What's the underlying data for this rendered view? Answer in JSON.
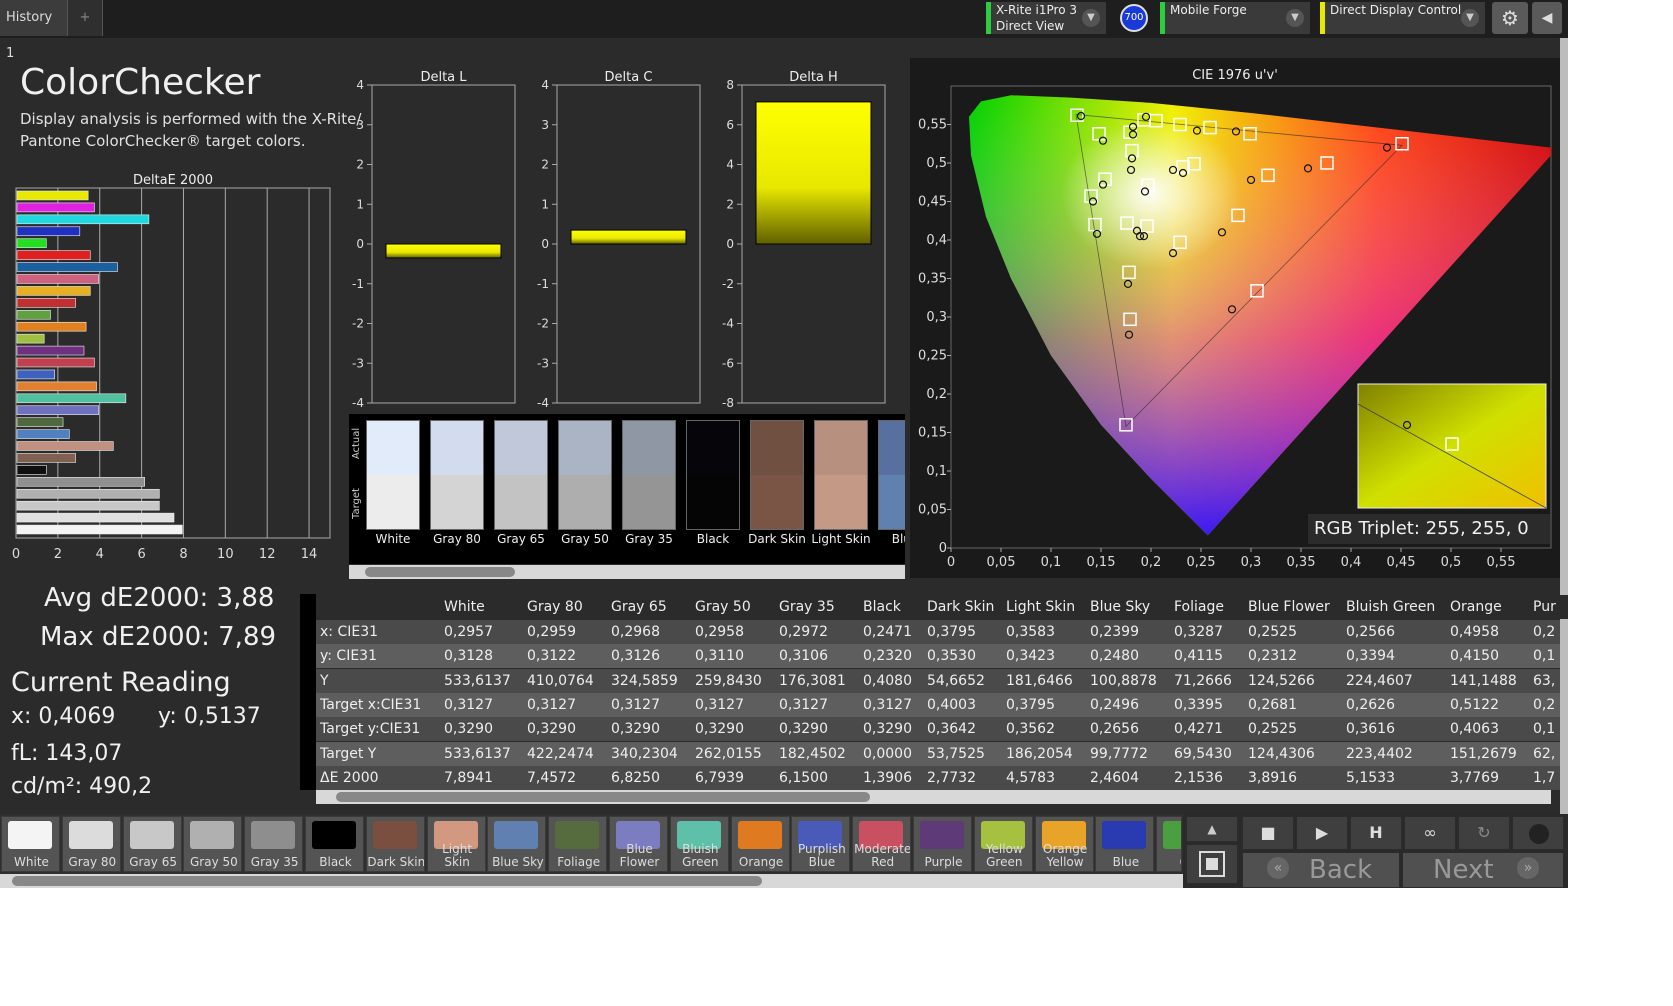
{
  "tabs": [
    {
      "label": "History 1"
    }
  ],
  "tab_add": "+",
  "devices": [
    {
      "line1": "X-Rite i1Pro 3",
      "line2": "Direct View"
    },
    {
      "line1": "Mobile Forge",
      "line2": ""
    },
    {
      "line1": "Direct Display Control",
      "line2": ""
    }
  ],
  "device_badge": "700",
  "page": {
    "title": "ColorChecker",
    "description_l1": "Display analysis is performed with the X-Rite/",
    "description_l2": "Pantone ColorChecker® target colors."
  },
  "summary": {
    "avg": "Avg dE2000: 3,88",
    "max": "Max dE2000: 7,89",
    "current_reading": "Current Reading",
    "x": "x: 0,4069",
    "y": "y: 0,5137",
    "fl": "fL: 143,07",
    "cdm": "cd/m²: 490,2"
  },
  "chart_data": [
    {
      "type": "bar",
      "title": "DeltaE 2000",
      "orientation": "horizontal",
      "xlim": [
        0,
        15
      ],
      "xticks": [
        "0",
        "2",
        "4",
        "6",
        "8",
        "10",
        "12",
        "14"
      ],
      "bars": [
        {
          "value": 3.4,
          "color": "#e8e800"
        },
        {
          "value": 3.7,
          "color": "#e020e0"
        },
        {
          "value": 6.3,
          "color": "#20d8e0"
        },
        {
          "value": 3.0,
          "color": "#2030c0"
        },
        {
          "value": 1.4,
          "color": "#20e020"
        },
        {
          "value": 3.5,
          "color": "#e02020"
        },
        {
          "value": 4.8,
          "color": "#1a60a0"
        },
        {
          "value": 3.9,
          "color": "#d06080"
        },
        {
          "value": 3.5,
          "color": "#e8b020"
        },
        {
          "value": 2.8,
          "color": "#c03030"
        },
        {
          "value": 1.6,
          "color": "#60a040"
        },
        {
          "value": 3.3,
          "color": "#e08020"
        },
        {
          "value": 1.3,
          "color": "#a0c040"
        },
        {
          "value": 3.2,
          "color": "#703080"
        },
        {
          "value": 3.7,
          "color": "#c04050"
        },
        {
          "value": 1.8,
          "color": "#4060c0"
        },
        {
          "value": 3.8,
          "color": "#e08030"
        },
        {
          "value": 5.2,
          "color": "#50c0a0"
        },
        {
          "value": 3.9,
          "color": "#7070c0"
        },
        {
          "value": 2.2,
          "color": "#506840"
        },
        {
          "value": 2.5,
          "color": "#5080c0"
        },
        {
          "value": 4.6,
          "color": "#c09080"
        },
        {
          "value": 2.8,
          "color": "#806050"
        },
        {
          "value": 1.4,
          "color": "#101010"
        },
        {
          "value": 6.1,
          "color": "#909090"
        },
        {
          "value": 6.8,
          "color": "#b0b0b0"
        },
        {
          "value": 6.8,
          "color": "#c8c8c8"
        },
        {
          "value": 7.5,
          "color": "#e0e0e0"
        },
        {
          "value": 7.9,
          "color": "#f4f4f4"
        }
      ]
    },
    {
      "type": "bar",
      "title": "Delta L",
      "ylim": [
        -4,
        4
      ],
      "yticks": [
        "4",
        "3",
        "2",
        "1",
        "0",
        "-1",
        "-2",
        "-3",
        "-4"
      ],
      "values": [
        -0.35
      ]
    },
    {
      "type": "bar",
      "title": "Delta C",
      "ylim": [
        -4,
        4
      ],
      "yticks": [
        "4",
        "3",
        "2",
        "1",
        "0",
        "-1",
        "-2",
        "-3",
        "-4"
      ],
      "values": [
        0.35
      ]
    },
    {
      "type": "bar",
      "title": "Delta H",
      "ylim": [
        -8,
        8
      ],
      "yticks": [
        "8",
        "6",
        "4",
        "2",
        "0",
        "-2",
        "-4",
        "-6",
        "-8"
      ],
      "values": [
        7.15
      ]
    },
    {
      "type": "scatter",
      "title": "CIE 1976 u'v'",
      "xlim": [
        0,
        0.6
      ],
      "ylim": [
        0,
        0.6
      ],
      "xticks": [
        "0",
        "0,05",
        "0,1",
        "0,15",
        "0,2",
        "0,25",
        "0,3",
        "0,35",
        "0,4",
        "0,45",
        "0,5",
        "0,55"
      ],
      "yticks": [
        "0",
        "0,05",
        "0,1",
        "0,15",
        "0,2",
        "0,25",
        "0,3",
        "0,35",
        "0,4",
        "0,45",
        "0,5",
        "0,55"
      ],
      "targets": [
        [
          0.126,
          0.562
        ],
        [
          0.148,
          0.538
        ],
        [
          0.179,
          0.54
        ],
        [
          0.193,
          0.556
        ],
        [
          0.205,
          0.555
        ],
        [
          0.229,
          0.55
        ],
        [
          0.259,
          0.546
        ],
        [
          0.299,
          0.538
        ],
        [
          0.181,
          0.516
        ],
        [
          0.232,
          0.495
        ],
        [
          0.243,
          0.499
        ],
        [
          0.317,
          0.484
        ],
        [
          0.376,
          0.5
        ],
        [
          0.451,
          0.525
        ],
        [
          0.154,
          0.479
        ],
        [
          0.197,
          0.471
        ],
        [
          0.14,
          0.457
        ],
        [
          0.287,
          0.432
        ],
        [
          0.144,
          0.42
        ],
        [
          0.176,
          0.422
        ],
        [
          0.196,
          0.418
        ],
        [
          0.229,
          0.397
        ],
        [
          0.178,
          0.358
        ],
        [
          0.306,
          0.334
        ],
        [
          0.179,
          0.297
        ],
        [
          0.175,
          0.16
        ]
      ],
      "measured": [
        [
          0.13,
          0.561
        ],
        [
          0.152,
          0.529
        ],
        [
          0.182,
          0.547
        ],
        [
          0.195,
          0.56
        ],
        [
          0.246,
          0.542
        ],
        [
          0.285,
          0.541
        ],
        [
          0.182,
          0.537
        ],
        [
          0.181,
          0.506
        ],
        [
          0.18,
          0.491
        ],
        [
          0.222,
          0.491
        ],
        [
          0.232,
          0.487
        ],
        [
          0.3,
          0.478
        ],
        [
          0.357,
          0.493
        ],
        [
          0.436,
          0.52
        ],
        [
          0.152,
          0.472
        ],
        [
          0.142,
          0.45
        ],
        [
          0.194,
          0.463
        ],
        [
          0.146,
          0.408
        ],
        [
          0.189,
          0.405
        ],
        [
          0.193,
          0.405
        ],
        [
          0.222,
          0.383
        ],
        [
          0.271,
          0.41
        ],
        [
          0.177,
          0.343
        ],
        [
          0.178,
          0.277
        ],
        [
          0.281,
          0.31
        ],
        [
          0.186,
          0.412
        ]
      ],
      "inset_label": "RGB Triplet: 255, 255, 0"
    }
  ],
  "swatch_strip": {
    "side_actual": "Actual",
    "side_target": "Target",
    "items": [
      {
        "name": "White",
        "actual": "#e1ebfa",
        "target": "#ececec"
      },
      {
        "name": "Gray 80",
        "actual": "#d2dcee",
        "target": "#d4d4d4"
      },
      {
        "name": "Gray 65",
        "actual": "#c0c8da",
        "target": "#c3c3c3"
      },
      {
        "name": "Gray 50",
        "actual": "#abb4c4",
        "target": "#aeaeae"
      },
      {
        "name": "Gray 35",
        "actual": "#8f96a4",
        "target": "#959595"
      },
      {
        "name": "Black",
        "actual": "#06060a",
        "target": "#050505"
      },
      {
        "name": "Dark Skin",
        "actual": "#705040",
        "target": "#7a5545"
      },
      {
        "name": "Light Skin",
        "actual": "#b89080",
        "target": "#c49a86"
      },
      {
        "name": "Blue",
        "actual": "#5870a0",
        "target": "#6080b0"
      }
    ]
  },
  "table": {
    "columns": [
      "White",
      "Gray 80",
      "Gray 65",
      "Gray 50",
      "Gray 35",
      "Black",
      "Dark Skin",
      "Light Skin",
      "Blue Sky",
      "Foliage",
      "Blue Flower",
      "Bluish Green",
      "Orange",
      "Pur"
    ],
    "rows": [
      {
        "label": "x: CIE31",
        "values": [
          "0,2957",
          "0,2959",
          "0,2968",
          "0,2958",
          "0,2972",
          "0,2471",
          "0,3795",
          "0,3583",
          "0,2399",
          "0,3287",
          "0,2525",
          "0,2566",
          "0,4958",
          "0,2"
        ]
      },
      {
        "label": "y: CIE31",
        "values": [
          "0,3128",
          "0,3122",
          "0,3126",
          "0,3110",
          "0,3106",
          "0,2320",
          "0,3530",
          "0,3423",
          "0,2480",
          "0,4115",
          "0,2312",
          "0,3394",
          "0,4150",
          "0,1"
        ]
      },
      {
        "label": "Y",
        "values": [
          "533,6137",
          "410,0764",
          "324,5859",
          "259,8430",
          "176,3081",
          "0,4080",
          "54,6652",
          "181,6466",
          "100,8878",
          "71,2666",
          "124,5266",
          "224,4607",
          "141,1488",
          "63,"
        ]
      },
      {
        "label": "Target x:CIE31",
        "values": [
          "0,3127",
          "0,3127",
          "0,3127",
          "0,3127",
          "0,3127",
          "0,3127",
          "0,4003",
          "0,3795",
          "0,2496",
          "0,3395",
          "0,2681",
          "0,2626",
          "0,5122",
          "0,2"
        ]
      },
      {
        "label": "Target y:CIE31",
        "values": [
          "0,3290",
          "0,3290",
          "0,3290",
          "0,3290",
          "0,3290",
          "0,3290",
          "0,3642",
          "0,3562",
          "0,2656",
          "0,4271",
          "0,2525",
          "0,3616",
          "0,4063",
          "0,1"
        ]
      },
      {
        "label": "Target Y",
        "values": [
          "533,6137",
          "422,2474",
          "340,2304",
          "262,0155",
          "182,4502",
          "0,0000",
          "53,7525",
          "186,2054",
          "99,7772",
          "69,5430",
          "124,4306",
          "223,4402",
          "151,2679",
          "62,"
        ]
      },
      {
        "label": "ΔE 2000",
        "values": [
          "7,8941",
          "7,4572",
          "6,8250",
          "6,7939",
          "6,1500",
          "1,3906",
          "2,7732",
          "4,5783",
          "2,4604",
          "2,1536",
          "3,8916",
          "5,1533",
          "3,7769",
          "1,7"
        ]
      }
    ]
  },
  "bottom_swatches": [
    {
      "label": "White",
      "color": "#f4f4f4"
    },
    {
      "label": "Gray 80",
      "color": "#dcdcdc"
    },
    {
      "label": "Gray 65",
      "color": "#c8c8c8"
    },
    {
      "label": "Gray 50",
      "color": "#b0b0b0"
    },
    {
      "label": "Gray 35",
      "color": "#8e8e8e"
    },
    {
      "label": "Black",
      "color": "#000000"
    },
    {
      "label": "Dark Skin",
      "color": "#7a4f40"
    },
    {
      "label": "Light Skin",
      "color": "#d29880"
    },
    {
      "label": "Blue Sky",
      "color": "#5f80b0"
    },
    {
      "label": "Foliage",
      "color": "#576c3e"
    },
    {
      "label": "Blue Flower",
      "color": "#7c7cc0"
    },
    {
      "label": "Bluish Green",
      "color": "#5ec0a8"
    },
    {
      "label": "Orange",
      "color": "#e07a20"
    },
    {
      "label": "Purplish Blue",
      "color": "#4a5ab8"
    },
    {
      "label": "Moderate Red",
      "color": "#c85060"
    },
    {
      "label": "Purple",
      "color": "#5e3a78"
    },
    {
      "label": "Yellow Green",
      "color": "#a6c040"
    },
    {
      "label": "Orange Yellow",
      "color": "#e8a428"
    },
    {
      "label": "Blue",
      "color": "#2a3ab0"
    },
    {
      "label": "Gr",
      "color": "#4aa040"
    }
  ],
  "nav": {
    "back": "Back",
    "next": "Next"
  },
  "colors": {
    "background": "#2b2b2b",
    "accent_green": "#2ecc40",
    "accent_yellow": "#e8e800",
    "badge_blue": "#1a3ad8"
  }
}
